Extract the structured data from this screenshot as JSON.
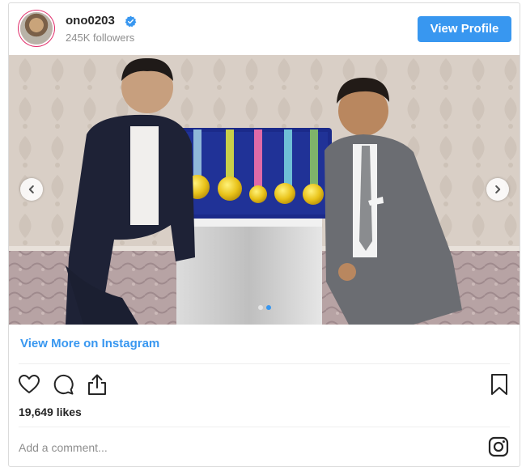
{
  "profile": {
    "username": "ono0203",
    "followers": "245K followers",
    "view_profile_label": "View Profile"
  },
  "post": {
    "carousel": {
      "total_slides": 2,
      "active_slide": 2
    },
    "view_more_label": "View More on Instagram",
    "likes": "19,649 likes",
    "comment_placeholder": "Add a comment..."
  },
  "colors": {
    "link_blue": "#3897f0",
    "text": "#262626",
    "muted": "#8e8e8e",
    "border": "#dbdbdb"
  },
  "icons": [
    "verified-badge-icon",
    "chevron-left-icon",
    "chevron-right-icon",
    "heart-icon",
    "comment-icon",
    "share-icon",
    "bookmark-icon",
    "instagram-icon"
  ]
}
